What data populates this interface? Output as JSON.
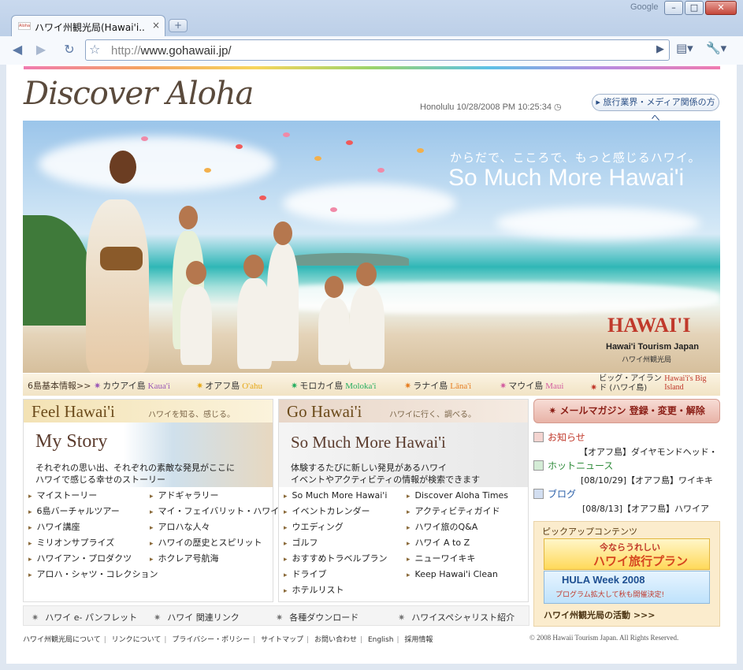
{
  "browser": {
    "corner_label": "Google",
    "window_buttons": [
      "–",
      "□",
      "✕"
    ],
    "tab_title": "ハワイ州観光局(Hawai'i...",
    "tab_favicon": "Aloha",
    "tab_close": "×",
    "new_tab": "+",
    "url_scheme": "http://",
    "url_host": "www.gohawaii.jp/",
    "icons": {
      "back": "◀",
      "forward": "▶",
      "reload": "↻",
      "star": "☆",
      "go": "▶",
      "page": "▤▾",
      "wrench": "🔧▾"
    }
  },
  "header": {
    "logo": "Discover Aloha",
    "clock": "Honolulu 10/28/2008 PM 10:25:34 ◷",
    "media_link": "▸ 旅行業界・メディア関係の方へ"
  },
  "hero": {
    "tagline_jp": "からだで、こころで、もっと感じるハワイ。",
    "tagline_en": "So Much More Hawai'i",
    "logo": "HAWAI'I",
    "logo_sub": "Hawai'i Tourism Japan",
    "logo_sub_jp": "ハワイ州観光局"
  },
  "islands": {
    "label": "6島基本情報>>",
    "items": [
      {
        "jp": "カウアイ島",
        "en": "Kaua'i",
        "color": "#9b59b6"
      },
      {
        "jp": "オアフ島",
        "en": "O'ahu",
        "color": "#e6a817"
      },
      {
        "jp": "モロカイ島",
        "en": "Moloka'i",
        "color": "#27ae60"
      },
      {
        "jp": "ラナイ島",
        "en": "Lāna'i",
        "color": "#e67e22"
      },
      {
        "jp": "マウイ島",
        "en": "Maui",
        "color": "#d35fa0"
      },
      {
        "jp": "ビッグ・アイランド (ハワイ島)",
        "en": "Hawai'i's Big Island",
        "color": "#c0392b"
      }
    ]
  },
  "feel": {
    "title": "Feel Hawai'i",
    "subtitle": "ハワイを知る、感じる。",
    "story_title": "My Story",
    "story_desc1": "それぞれの思い出、それぞれの素敵な発見がここに",
    "story_desc2": "ハワイで感じる幸せのストーリー",
    "col1": [
      "マイストーリー",
      "6島バーチャルツアー",
      "ハワイ講座",
      "ミリオンサプライズ",
      "ハワイアン・プロダクツ",
      "アロハ・シャツ・コレクション"
    ],
    "col2": [
      "アドギャラリー",
      "マイ・フェイバリット・ハワイ",
      "アロハな人々",
      "ハワイの歴史とスピリット",
      "ホクレア号航海"
    ]
  },
  "go": {
    "title": "Go Hawai'i",
    "subtitle": "ハワイに行く、調べる。",
    "feature_title": "So Much More Hawai'i",
    "feature_desc1": "体験するたびに新しい発見があるハワイ",
    "feature_desc2": "イベントやアクティビティの情報が検索できます",
    "col1": [
      "So Much More Hawai'i",
      "イベントカレンダー",
      "ウエディング",
      "ゴルフ",
      "おすすめトラベルプラン",
      "ドライブ",
      "ホテルリスト"
    ],
    "col2": [
      "Discover Aloha Times",
      "アクティビティガイド",
      "ハワイ旅のQ&A",
      "ハワイ A to Z",
      "ニューワイキキ",
      "Keep Hawai'i Clean"
    ]
  },
  "sidebar": {
    "mail_magazine": "✷ メールマガジン 登録・変更・解除",
    "news": [
      {
        "title": "お知らせ",
        "item": "【オアフ島】ダイヤモンドヘッド・",
        "color": "#c0392b"
      },
      {
        "title": "ホットニュース",
        "item": "[08/10/29]【オアフ島】ワイキキ",
        "color": "#2e8b3a"
      },
      {
        "title": "ブログ",
        "item": "[08/8/13]【オアフ島】ハワイア",
        "color": "#2a5fa8"
      }
    ],
    "pickup_title": "ピックアップコンテンツ",
    "banner1_top": "今ならうれしい",
    "banner1_main": "ハワイ旅行プラン",
    "banner2_main": "HULA Week 2008",
    "banner2_sub": "プログラム拡大して秋も開催決定!",
    "pickup_footer": "ハワイ州観光局の活動 >>>"
  },
  "bottom_links": [
    "ハワイ e- パンフレット",
    "ハワイ 関連リンク",
    "各種ダウンロード",
    "ハワイスペシャリスト紹介"
  ],
  "footer": {
    "links": [
      "ハワイ州観光局について",
      "リンクについて",
      "プライバシー・ポリシー",
      "サイトマップ",
      "お問い合わせ",
      "English",
      "採用情報"
    ],
    "copyright": "© 2008 Hawaii Tourism Japan. All Rights Reserved."
  }
}
